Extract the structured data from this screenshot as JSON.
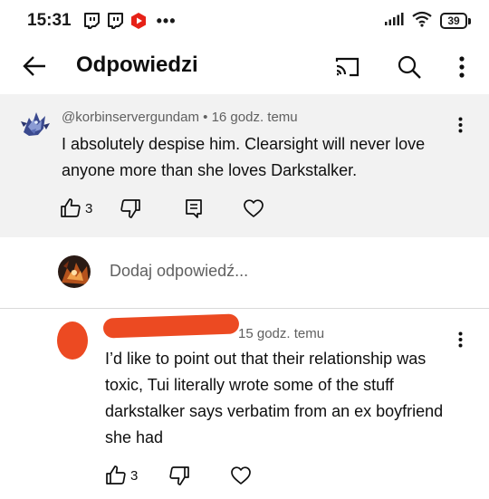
{
  "status_bar": {
    "time": "15:31",
    "more": "•••",
    "battery": "39"
  },
  "header": {
    "title": "Odpowiedzi"
  },
  "parent_comment": {
    "handle": "@korbinservergundam",
    "separator": "•",
    "time_ago": "16 godz. temu",
    "text": "I absolutely despise him. Clearsight will never love anyone more than she loves Darkstalker.",
    "like_count": "3"
  },
  "reply_box": {
    "placeholder": "Dodaj odpowiedź..."
  },
  "reply_comment": {
    "time_ago": "15 godz. temu",
    "text": "I’d like to point out that their relationship was toxic, Tui literally wrote some of the stuff darkstalker says verbatim from an ex boyfriend she had",
    "like_count": "3"
  },
  "colors": {
    "redaction": "#ec4a22",
    "parent_background": "#f2f2f2",
    "secondary_text": "#606060"
  },
  "icons": [
    "twitch-icon",
    "youtube-icon",
    "signal-icon",
    "wifi-icon",
    "battery-icon",
    "back-arrow-icon",
    "cast-icon",
    "search-icon",
    "more-vert-icon",
    "thumb-up-icon",
    "thumb-down-icon",
    "reply-comment-icon",
    "heart-icon"
  ]
}
